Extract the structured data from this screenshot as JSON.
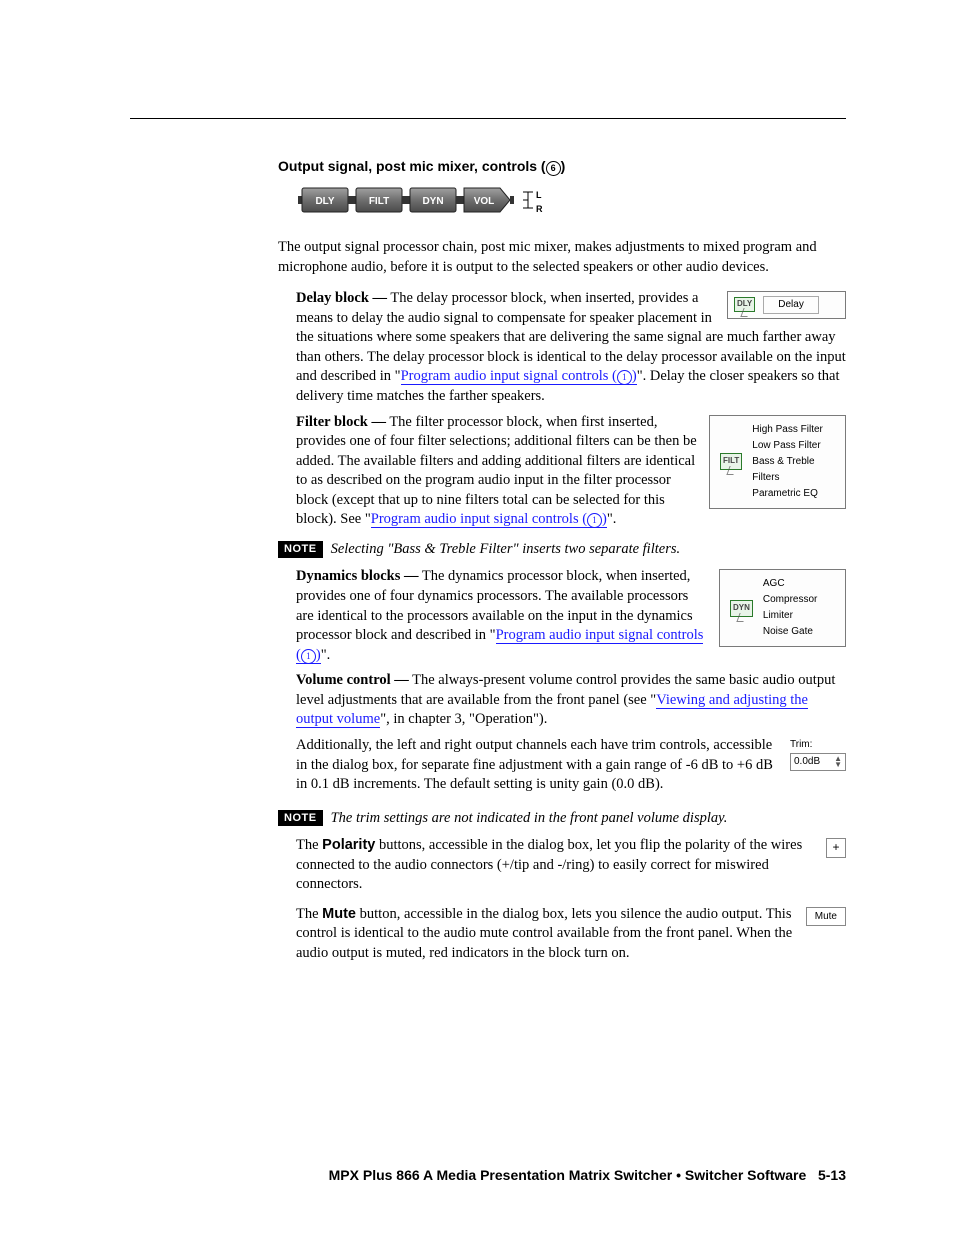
{
  "heading": {
    "prefix": "Output signal, post mic mixer, controls",
    "marker": "6"
  },
  "chain_labels": [
    "DLY",
    "FILT",
    "DYN",
    "VOL"
  ],
  "chain_lr": {
    "l": "L",
    "r": "R"
  },
  "intro": "The output signal processor chain, post mic mixer, makes adjustments to mixed program and microphone audio, before it is output to the selected speakers or other audio devices.",
  "delay": {
    "lead": "Delay block —",
    "p1a": " The delay processor block, when inserted, provides a means to delay the audio signal to compensate for speaker placement in the situations where some speakers that are delivering the same signal are much farther away than others.  The delay processor block is identical to the delay processor available on the input and described in \"",
    "link": "Program audio input signal controls (",
    "marker": "1",
    "link_tail": ")",
    "p1b": "\".  Delay the closer speakers so that delivery time matches the farther speakers.",
    "box_icon": "DLY",
    "box_label": "Delay"
  },
  "filter": {
    "lead": "Filter block —",
    "p1": " The filter processor block, when first inserted, provides one of four filter selections; additional filters can be then be added.  The available filters and adding additional filters are identical to as described on the program audio input in the filter processor block (except that up to nine filters total can be selected for this block).  See \"",
    "link": "Program audio input signal controls (",
    "marker": "1",
    "link_tail": ")",
    "p1b": "\".",
    "box_icon": "FILT",
    "options": [
      "High Pass Filter",
      "Low Pass Filter",
      "Bass & Treble Filters",
      "Parametric EQ"
    ]
  },
  "note1": {
    "badge": "NOTE",
    "text": "Selecting \"Bass & Treble Filter\" inserts two separate filters."
  },
  "dyn": {
    "lead": "Dynamics blocks —",
    "p1": " The dynamics processor block, when inserted, provides one of four dynamics processors.  The available processors are identical to the processors available on the input in the dynamics processor block and described in \"",
    "link": "Program audio input signal controls (",
    "marker": "1",
    "link_tail": ")",
    "p1b": "\".",
    "box_icon": "DYN",
    "options": [
      "AGC",
      "Compressor",
      "Limiter",
      "Noise Gate"
    ]
  },
  "vol": {
    "lead": "Volume control —",
    "p1a": " The always-present volume control provides the same basic audio output level adjustments that are available from the front panel (see \"",
    "link": "Viewing and adjusting the output volume",
    "p1b": "\", in chapter 3, \"Operation\").",
    "p2": "Additionally, the left and right output channels each have trim controls, accessible in the dialog box, for separate fine adjustment with a gain range of -6 dB to +6 dB in 0.1 dB increments.  The default setting is unity gain (0.0 dB).",
    "trim_label": "Trim:",
    "trim_value": "0.0dB"
  },
  "note2": {
    "badge": "NOTE",
    "text": "The trim settings are not indicated in the front panel volume display."
  },
  "polarity": {
    "pre": "The ",
    "strong": "Polarity",
    "post": " buttons, accessible in the dialog box, let you flip the polarity of the wires connected to the audio connectors (+/tip and -/ring) to easily correct for miswired connectors.",
    "box": "+"
  },
  "mute": {
    "pre": "The ",
    "strong": "Mute",
    "post": " button, accessible in the dialog box, lets you silence the audio output.  This control is identical to the audio mute control available from the front panel.  When the audio output is muted, red indicators in the block turn on.",
    "box": "Mute"
  },
  "footer": {
    "text": "MPX Plus 866 A Media Presentation Matrix Switcher • Switcher Software",
    "page": "5-13"
  }
}
